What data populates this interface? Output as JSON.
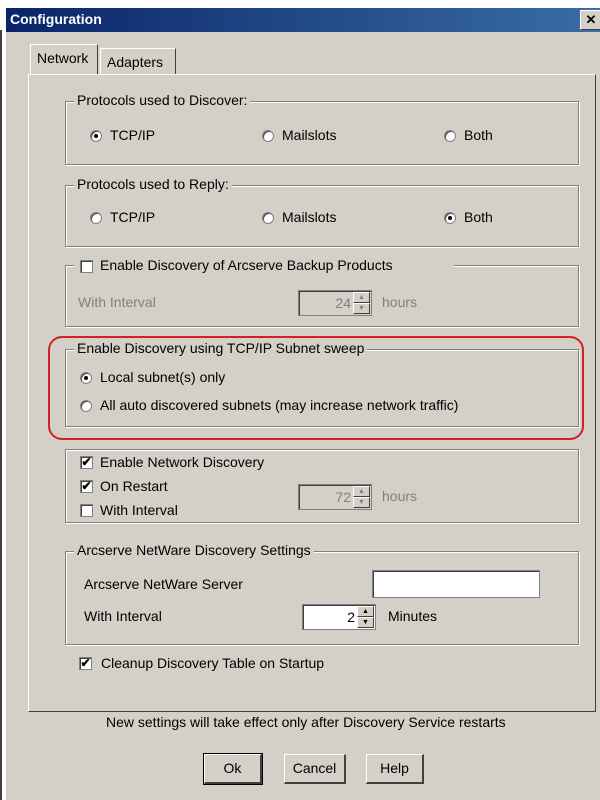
{
  "window": {
    "title": "Configuration",
    "close_glyph": "✕"
  },
  "tabs": [
    {
      "label": "Network"
    },
    {
      "label": "Adapters"
    }
  ],
  "discover": {
    "group_label": "Protocols used to Discover:",
    "options": [
      {
        "label": "TCP/IP",
        "selected": true
      },
      {
        "label": "Mailslots",
        "selected": false
      },
      {
        "label": "Both",
        "selected": false
      }
    ]
  },
  "reply": {
    "group_label": "Protocols used to Reply:",
    "options": [
      {
        "label": "TCP/IP",
        "selected": false
      },
      {
        "label": "Mailslots",
        "selected": false
      },
      {
        "label": "Both",
        "selected": true
      }
    ]
  },
  "arcserve_products": {
    "checkbox_label": "Enable Discovery of Arcserve Backup Products",
    "checked": false,
    "interval_label": "With Interval",
    "interval_value": "24",
    "unit": "hours"
  },
  "subnet_sweep": {
    "group_label": "Enable Discovery using TCP/IP Subnet sweep",
    "options": [
      {
        "label": "Local subnet(s) only",
        "selected": true
      },
      {
        "label": "All auto discovered subnets (may increase network traffic)",
        "selected": false
      }
    ],
    "highlight_color": "#d2202a"
  },
  "network_discovery": {
    "enable_label": "Enable Network Discovery",
    "enable_checked": true,
    "restart_label": "On Restart",
    "restart_checked": true,
    "interval_label": "With Interval",
    "interval_checked": false,
    "interval_value": "72",
    "unit": "hours"
  },
  "netware": {
    "group_label": "Arcserve NetWare Discovery Settings",
    "server_label": "Arcserve NetWare Server",
    "server_value": "",
    "interval_label": "With Interval",
    "interval_value": "2",
    "unit": "Minutes"
  },
  "cleanup": {
    "label": "Cleanup Discovery Table on Startup",
    "checked": true
  },
  "notice": "New settings will take effect only after Discovery Service restarts",
  "buttons": {
    "ok": "Ok",
    "cancel": "Cancel",
    "help": "Help"
  },
  "glyphs": {
    "check": "✔",
    "up": "▲",
    "down": "▼"
  }
}
